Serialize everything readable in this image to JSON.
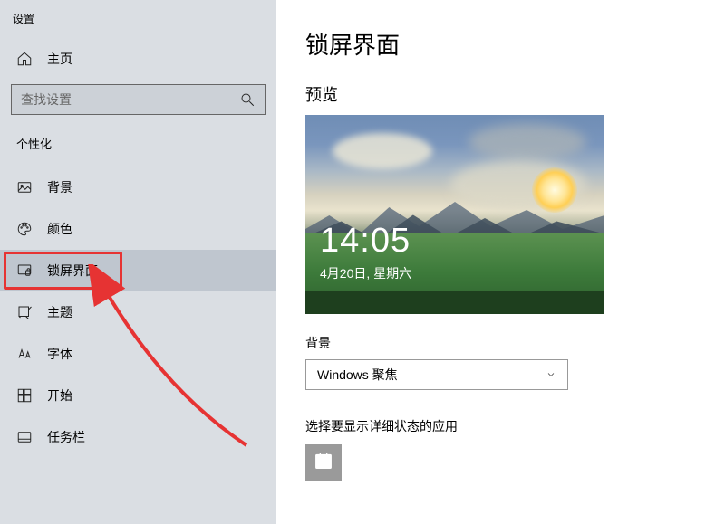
{
  "window_title": "设置",
  "home_label": "主页",
  "search_placeholder": "查找设置",
  "category": "个性化",
  "sidebar": {
    "items": [
      {
        "label": "背景"
      },
      {
        "label": "颜色"
      },
      {
        "label": "锁屏界面"
      },
      {
        "label": "主题"
      },
      {
        "label": "字体"
      },
      {
        "label": "开始"
      },
      {
        "label": "任务栏"
      }
    ]
  },
  "main": {
    "page_title": "锁屏界面",
    "preview_label": "预览",
    "preview_time": "14:05",
    "preview_date": "4月20日, 星期六",
    "background_section_label": "背景",
    "background_dropdown_value": "Windows 聚焦",
    "status_apps_label": "选择要显示详细状态的应用"
  }
}
